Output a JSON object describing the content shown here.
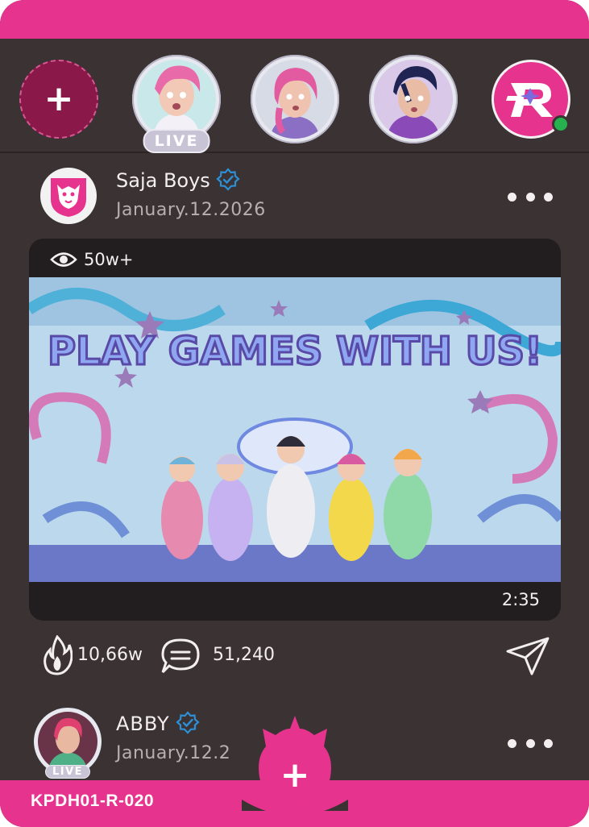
{
  "stories": {
    "add_symbol": "+",
    "live_label": "LIVE",
    "items": [
      {
        "avatar": "pink-hair-member-avatar",
        "live": true
      },
      {
        "avatar": "magenta-hair-member-avatar",
        "live": false
      },
      {
        "avatar": "dark-hair-member-avatar",
        "live": false
      }
    ],
    "brand_logo": "r-star-logo",
    "online_color": "#27b14e"
  },
  "post": {
    "username": "Saja Boys",
    "date": "January.12.2026",
    "views": "50w+",
    "duration": "2:35",
    "media_text": "PLAY GAMES WITH US!",
    "likes": "10,66w",
    "comments": "51,240"
  },
  "post2": {
    "username": "ABBY",
    "date": "January.12.2",
    "live_label": "LIVE"
  },
  "fab": {
    "symbol": "+"
  },
  "card_code": "KPDH01-R-020",
  "colors": {
    "brand_pink": "#e6338e",
    "card_bg": "#3a3233",
    "media_bg": "#221d1e",
    "verified_blue": "#2d8fd6"
  }
}
